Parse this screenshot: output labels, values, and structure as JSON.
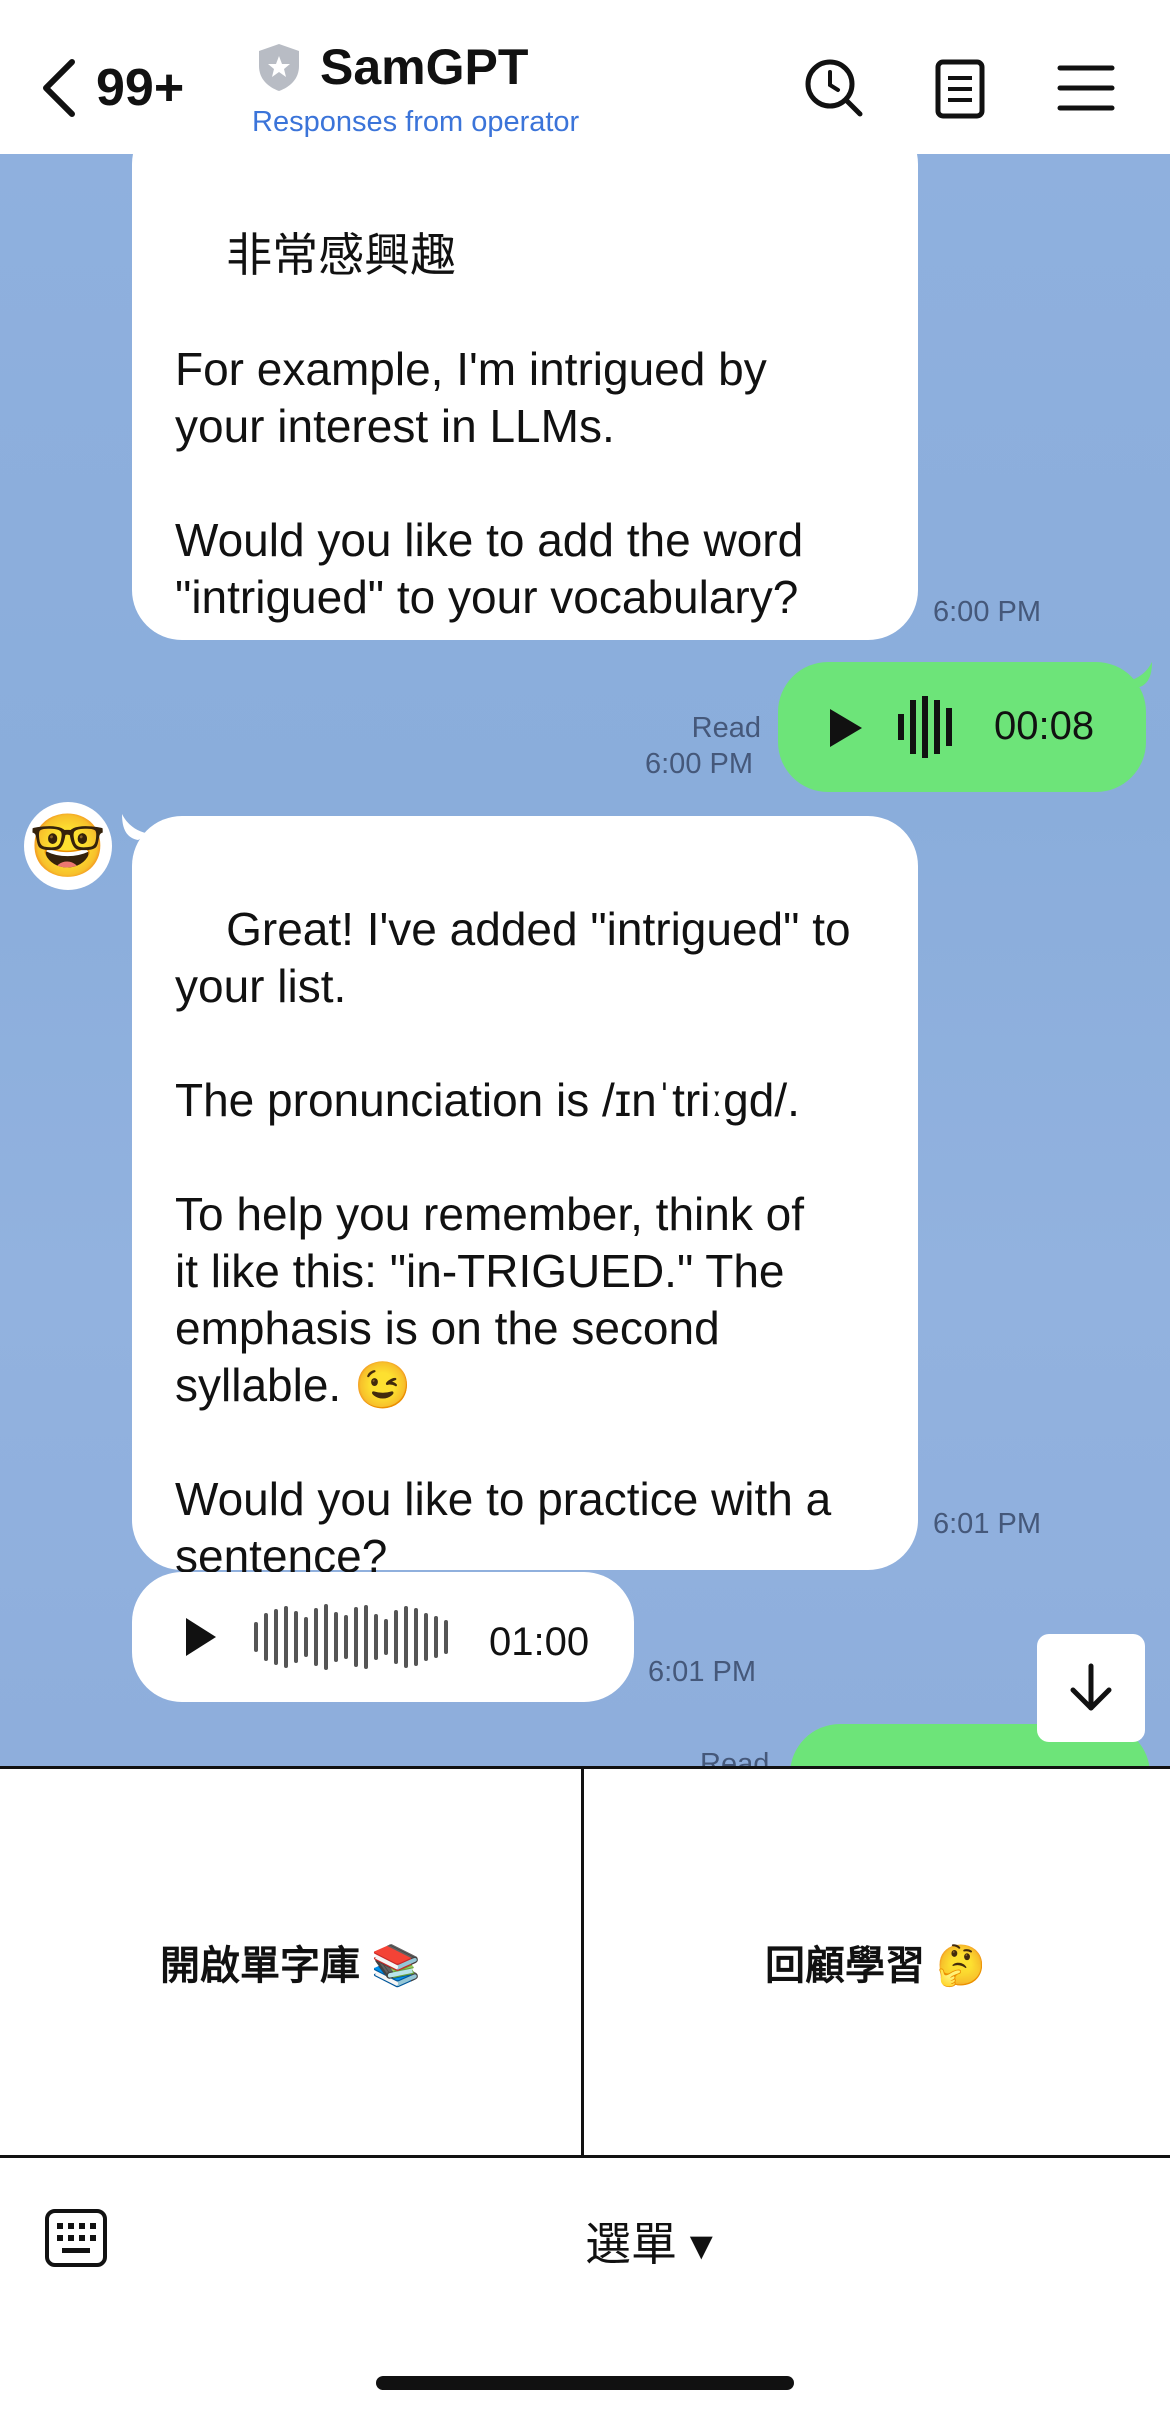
{
  "header": {
    "back_count": "99+",
    "title": "SamGPT",
    "subtitle": "Responses from operator",
    "icons": [
      "back-chevron-icon",
      "shield-icon",
      "search-history-icon",
      "notes-icon",
      "menu-icon"
    ]
  },
  "messages": {
    "m1": {
      "text": "非常感興趣\n\nFor example, I'm intrigued by\nyour interest in LLMs.\n\nWould you like to add the word\n\"intrigued\" to your vocabulary?",
      "time": "6:00 PM"
    },
    "m2": {
      "read": "Read",
      "time": "6:00 PM",
      "duration": "00:08"
    },
    "m3": {
      "text": "Great! I've added \"intrigued\" to\nyour list.\n\nThe pronunciation is /ɪnˈtriːgd/.\n\nTo help you remember, think of\nit like this: \"in-TRIGUED.\" The\nemphasis is on the second\nsyllable. 😉\n\nWould you like to practice with a\nsentence?",
      "time": "6:01 PM",
      "avatar": "🤓"
    },
    "m4": {
      "duration": "01:00",
      "time": "6:01 PM"
    },
    "m5": {
      "read": "Read"
    }
  },
  "rich_menu": {
    "left_label": "開啟單字庫 📚",
    "right_label": "回顧學習 🤔"
  },
  "bottom": {
    "menu_toggle_label": "選單 ▾"
  },
  "colors": {
    "chat_background": "#8fb0de",
    "outgoing_bubble": "#6de479",
    "subtitle": "#3b74d9"
  }
}
